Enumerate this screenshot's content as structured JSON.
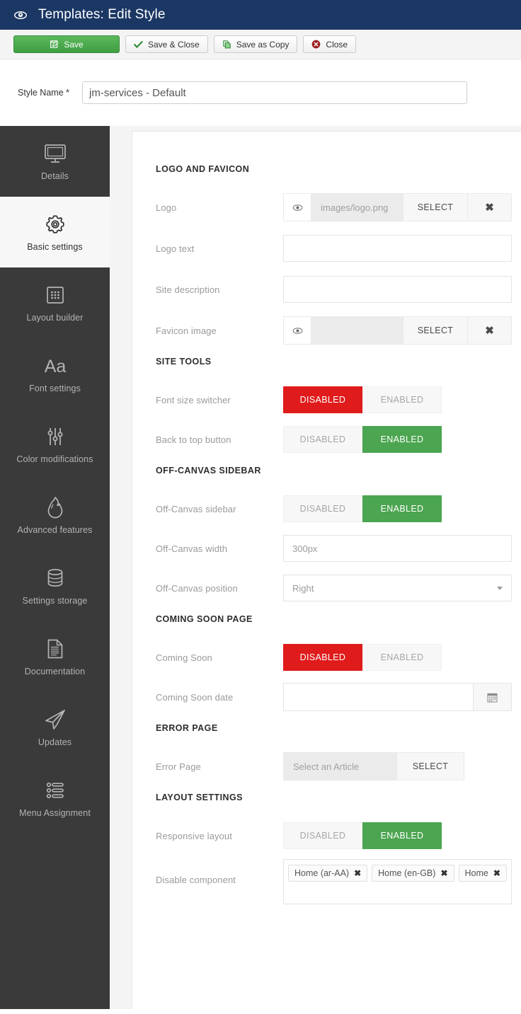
{
  "header": {
    "icon": "eye-icon",
    "title": "Templates: Edit Style"
  },
  "toolbar": {
    "save_label": "Save",
    "save_close_label": "Save & Close",
    "save_copy_label": "Save as Copy",
    "close_label": "Close"
  },
  "style_name": {
    "label": "Style Name *",
    "value": "jm-services - Default"
  },
  "sidebar": {
    "items": [
      {
        "label": "Details",
        "icon": "monitor-icon",
        "active": false
      },
      {
        "label": "Basic settings",
        "icon": "gear-icon",
        "active": true
      },
      {
        "label": "Layout builder",
        "icon": "grid-icon",
        "active": false
      },
      {
        "label": "Font settings",
        "icon": "font-aa-icon",
        "active": false
      },
      {
        "label": "Color modifications",
        "icon": "sliders-icon",
        "active": false
      },
      {
        "label": "Advanced features",
        "icon": "flame-icon",
        "active": false
      },
      {
        "label": "Settings storage",
        "icon": "database-icon",
        "active": false
      },
      {
        "label": "Documentation",
        "icon": "document-icon",
        "active": false
      },
      {
        "label": "Updates",
        "icon": "paper-plane-icon",
        "active": false
      },
      {
        "label": "Menu Assignment",
        "icon": "list-icon",
        "active": false
      }
    ]
  },
  "groups": {
    "logo_favicon": {
      "title": "LOGO AND FAVICON",
      "logo": {
        "label": "Logo",
        "value": "images/logo.png",
        "select_label": "SELECT",
        "clear_label": "✖"
      },
      "logo_text": {
        "label": "Logo text",
        "value": ""
      },
      "site_description": {
        "label": "Site description",
        "value": ""
      },
      "favicon": {
        "label": "Favicon image",
        "value": "",
        "select_label": "SELECT",
        "clear_label": "✖"
      }
    },
    "site_tools": {
      "title": "SITE TOOLS",
      "font_size_switcher": {
        "label": "Font size switcher",
        "off_label": "DISABLED",
        "on_label": "ENABLED",
        "state": "disabled"
      },
      "back_to_top": {
        "label": "Back to top button",
        "off_label": "DISABLED",
        "on_label": "ENABLED",
        "state": "enabled"
      }
    },
    "off_canvas": {
      "title": "OFF-CANVAS SIDEBAR",
      "sidebar": {
        "label": "Off-Canvas sidebar",
        "off_label": "DISABLED",
        "on_label": "ENABLED",
        "state": "enabled"
      },
      "width": {
        "label": "Off-Canvas width",
        "value": "300px"
      },
      "position": {
        "label": "Off-Canvas position",
        "value": "Right"
      }
    },
    "coming_soon": {
      "title": "COMING SOON PAGE",
      "toggle": {
        "label": "Coming Soon",
        "off_label": "DISABLED",
        "on_label": "ENABLED",
        "state": "disabled"
      },
      "date": {
        "label": "Coming Soon date",
        "value": ""
      }
    },
    "error_page": {
      "title": "ERROR PAGE",
      "field": {
        "label": "Error Page",
        "placeholder": "Select an Article",
        "select_label": "SELECT"
      }
    },
    "layout_settings": {
      "title": "LAYOUT SETTINGS",
      "responsive": {
        "label": "Responsive layout",
        "off_label": "DISABLED",
        "on_label": "ENABLED",
        "state": "enabled"
      },
      "disable_component": {
        "label": "Disable component",
        "chips": [
          "Home (ar-AA)",
          "Home (en-GB)",
          "Home"
        ],
        "chip_remove": "✖"
      }
    }
  },
  "colors": {
    "header_bg": "#1b3764",
    "sidebar_bg": "#3a3a3a",
    "accent_green": "#4ca551",
    "accent_red": "#e01b1b",
    "save_green": "#3f9e41"
  }
}
